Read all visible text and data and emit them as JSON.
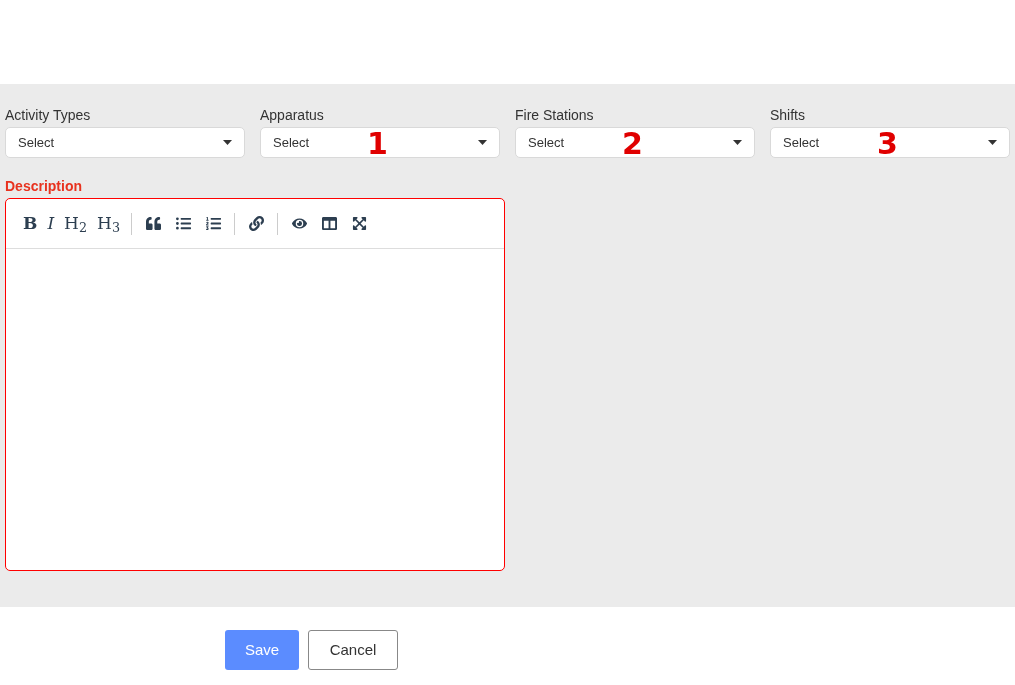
{
  "filters": [
    {
      "label": "Activity Types",
      "value": "Select"
    },
    {
      "label": "Apparatus",
      "value": "Select",
      "marker": "1"
    },
    {
      "label": "Fire Stations",
      "value": "Select",
      "marker": "2"
    },
    {
      "label": "Shifts",
      "value": "Select",
      "marker": "3"
    }
  ],
  "description": {
    "label": "Description",
    "error": true,
    "toolbar": [
      [
        {
          "kind": "bold",
          "label": "B"
        },
        {
          "kind": "italic",
          "label": "I"
        },
        {
          "kind": "heading",
          "label": "H$_{2}$"
        },
        {
          "kind": "heading",
          "label": "H$_{3}$"
        }
      ],
      [
        {
          "kind": "icon"
        },
        {
          "kind": "icon"
        },
        {
          "kind": "icon"
        }
      ],
      [
        {
          "kind": "icon"
        }
      ],
      [
        {
          "kind": "icon"
        },
        {
          "kind": "icon"
        },
        {
          "kind": "icon"
        }
      ]
    ]
  },
  "buttons": [
    {
      "label": "Save",
      "kind": "primary"
    },
    {
      "label": "Cancel",
      "kind": "secondary"
    }
  ]
}
